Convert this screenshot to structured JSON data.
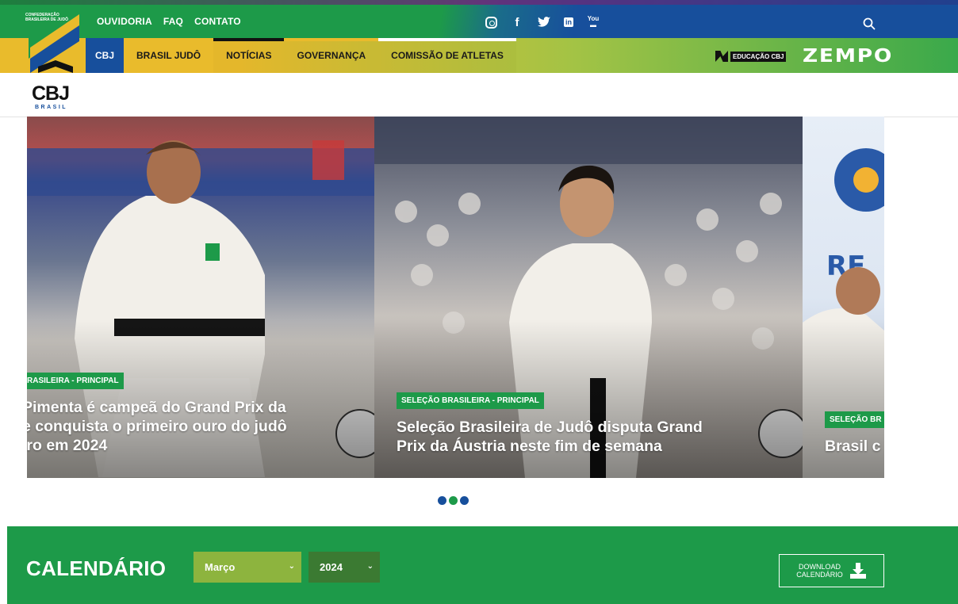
{
  "header": {
    "top_links": [
      "OUVIDORIA",
      "FAQ",
      "CONTATO"
    ],
    "social_icons": [
      "instagram-icon",
      "facebook-icon",
      "twitter-icon",
      "linkedin-icon",
      "youtube-icon"
    ],
    "youtube_glyph": "You",
    "search_icon": "search-icon"
  },
  "logo": {
    "small_text": "CONFEDERAÇÃO BRASILEIRA DE JUDÔ",
    "name": "CBJ",
    "country": "BRASIL"
  },
  "nav": {
    "items": [
      "CBJ",
      "BRASIL JUDÔ",
      "NOTÍCIAS",
      "GOVERNANÇA",
      "COMISSÃO DE ATLETAS"
    ],
    "edu_label": "EDUCAÇÃO CBJ",
    "zempo_label": "ZEMPO"
  },
  "carousel": {
    "slides": [
      {
        "tag": "RASILEIRA - PRINCIPAL",
        "title_lines": [
          "Pimenta é campeã do Grand Prix da",
          "e conquista o primeiro ouro do judô",
          "iro em 2024"
        ]
      },
      {
        "tag": "SELEÇÃO BRASILEIRA - PRINCIPAL",
        "title_lines": [
          "Seleção Brasileira de Judô disputa Grand",
          "Prix da Áustria neste fim de semana"
        ]
      },
      {
        "tag": "SELEÇÃO BR",
        "title_lines": [
          "Brasil c"
        ]
      }
    ],
    "dots": 3,
    "dot_color": "#174f9c"
  },
  "calendar": {
    "title": "CALENDÁRIO",
    "month": "Março",
    "year": "2024",
    "download_label_line1": "DOWNLOAD",
    "download_label_line2": "CALENDÁRIO"
  },
  "colors": {
    "green": "#1d9a49",
    "blue": "#174f9c",
    "yellow": "#e9bb2c"
  }
}
